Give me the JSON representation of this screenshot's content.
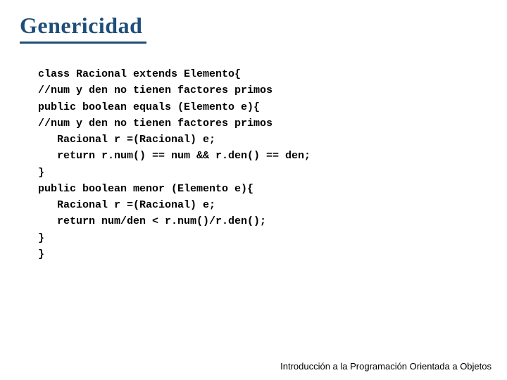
{
  "title": "Genericidad",
  "code": "class Racional extends Elemento{\n//num y den no tienen factores primos\npublic boolean equals (Elemento e){\n//num y den no tienen factores primos\n   Racional r =(Racional) e;\n   return r.num() == num && r.den() == den;\n}\npublic boolean menor (Elemento e){\n   Racional r =(Racional) e;\n   return num/den < r.num()/r.den();\n}\n}",
  "footer": "Introducción a la Programación Orientada a Objetos"
}
